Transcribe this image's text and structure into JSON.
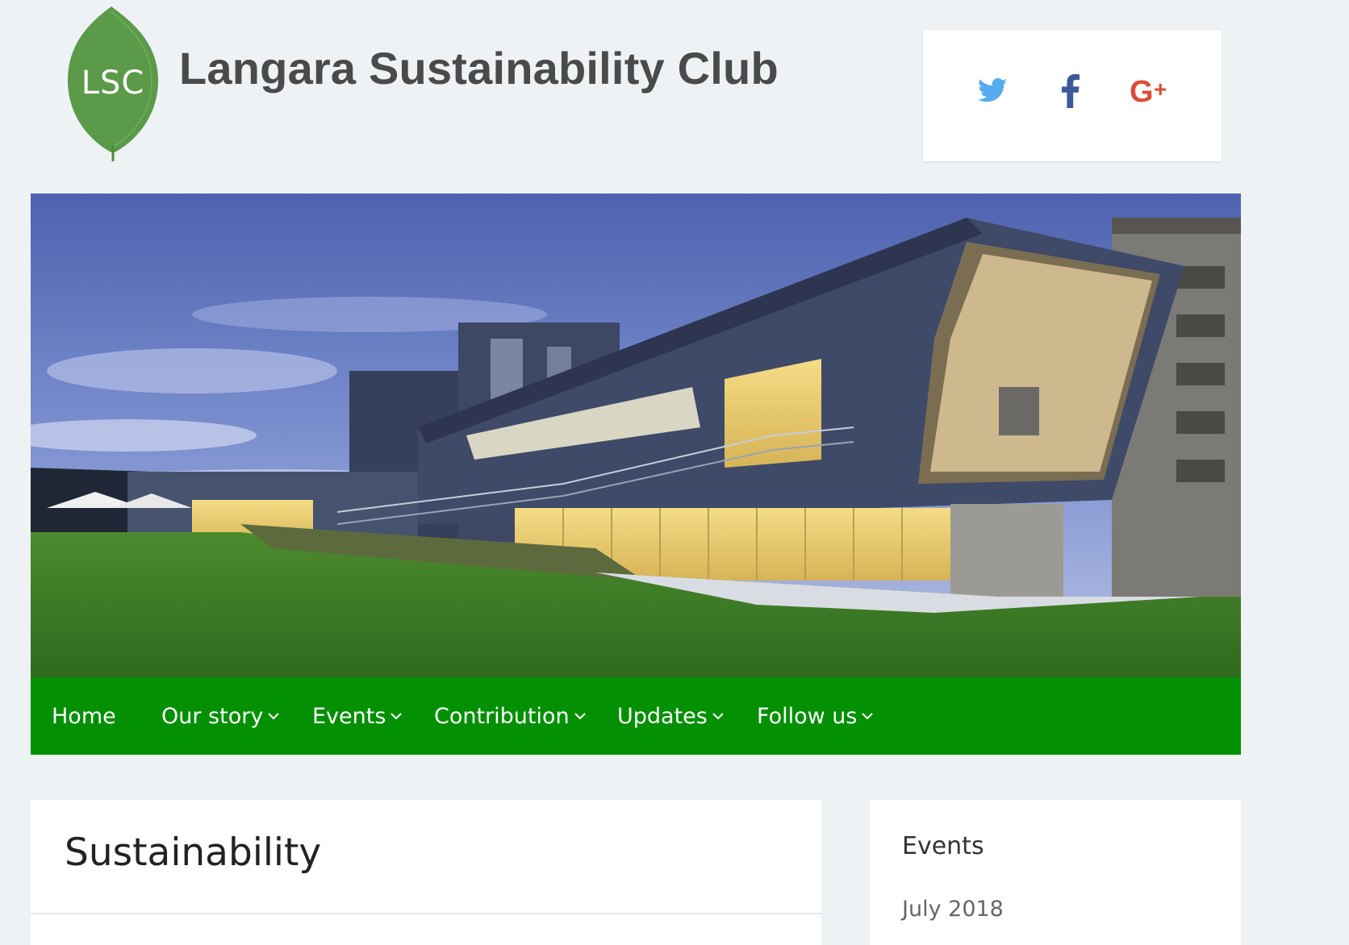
{
  "logo": {
    "text": "LSC",
    "color": "#5a9a48"
  },
  "site_title": "Langara Sustainability Club",
  "social": {
    "icons": [
      "twitter-icon",
      "facebook-icon",
      "google-plus-icon"
    ],
    "colors": {
      "twitter": "#55acee",
      "facebook": "#3b5998",
      "google_plus": "#dd4b39"
    }
  },
  "hero": {
    "icon": "campus-building-photo"
  },
  "nav": {
    "background": "#039003",
    "items": [
      {
        "label": "Home"
      },
      {
        "label": "Our story"
      },
      {
        "label": "Events"
      },
      {
        "label": "Contribution"
      },
      {
        "label": "Updates"
      },
      {
        "label": "Follow us"
      }
    ]
  },
  "main": {
    "title": "Sustainability"
  },
  "sidebar": {
    "heading": "Events",
    "items": [
      "July 2018"
    ]
  }
}
